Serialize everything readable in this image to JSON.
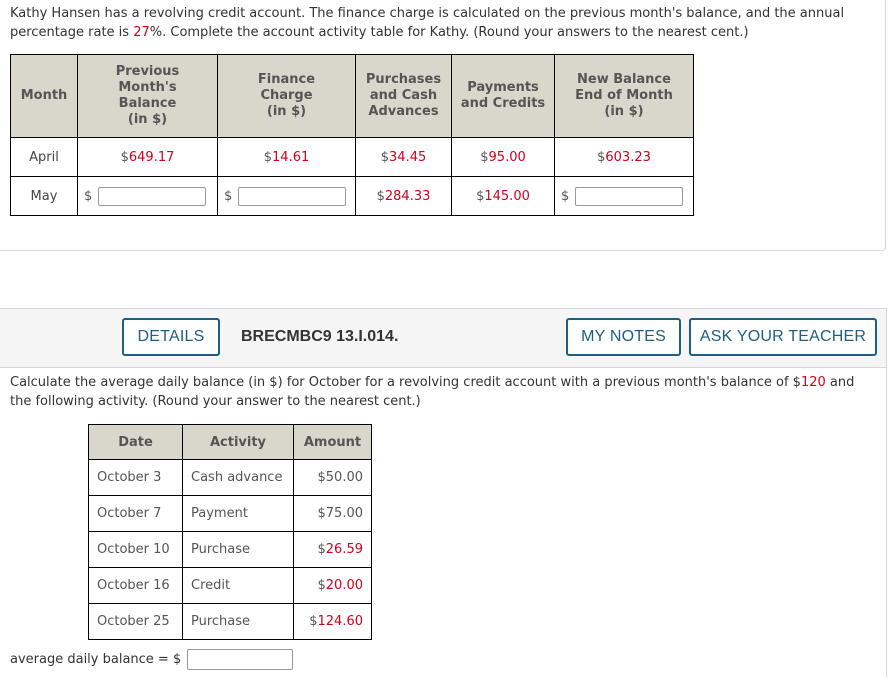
{
  "question1": {
    "text_before": "Kathy Hansen has a revolving credit account. The finance charge is calculated on the previous month's balance, and the annual percentage rate is ",
    "apr": "27",
    "text_after": "%. Complete the account activity table for Kathy. (Round your answers to the nearest cent.)",
    "table": {
      "headers": [
        "Month",
        "Previous Month's Balance (in $)",
        "Finance Charge (in $)",
        "Purchases and Cash Advances",
        "Payments and Credits",
        "New Balance End of Month (in $)"
      ],
      "header_lines": [
        [
          "Month"
        ],
        [
          "Previous",
          "Month's",
          "Balance",
          "(in $)"
        ],
        [
          "Finance",
          "Charge",
          "(in $)"
        ],
        [
          "Purchases",
          "and Cash",
          "Advances"
        ],
        [
          "Payments",
          "and Credits"
        ],
        [
          "New Balance",
          "End of Month",
          "(in $)"
        ]
      ],
      "rows": [
        {
          "month": "April",
          "previous_balance": "649.17",
          "finance_charge": "14.61",
          "purchases": "34.45",
          "payments": "95.00",
          "new_balance": "603.23"
        },
        {
          "month": "May",
          "previous_balance_input": "",
          "finance_charge_input": "",
          "purchases": "284.33",
          "payments": "145.00",
          "new_balance_input": ""
        }
      ],
      "currency": "$"
    }
  },
  "question2": {
    "header": {
      "details_label": "DETAILS",
      "code": "BRECMBC9 13.I.014.",
      "my_notes_label": "MY NOTES",
      "ask_teacher_label": "ASK YOUR TEACHER"
    },
    "text_before": "Calculate the average daily balance (in $) for October for a revolving credit account with a previous month's balance of $",
    "previous_balance": "120",
    "text_after": " and the following activity. (Round your answer to the nearest cent.)",
    "table": {
      "headers": [
        "Date",
        "Activity",
        "Amount"
      ],
      "rows": [
        {
          "date": "October 3",
          "activity": "Cash advance",
          "amount": "50.00",
          "highlight": false
        },
        {
          "date": "October 7",
          "activity": "Payment",
          "amount": "75.00",
          "highlight": false
        },
        {
          "date": "October 10",
          "activity": "Purchase",
          "amount": "26.59",
          "highlight": true
        },
        {
          "date": "October 16",
          "activity": "Credit",
          "amount": "20.00",
          "highlight": true
        },
        {
          "date": "October 25",
          "activity": "Purchase",
          "amount": "124.60",
          "highlight": true
        }
      ]
    },
    "answer_label": "average daily balance = $",
    "answer_value": ""
  },
  "colors": {
    "accent": "#1d5e84",
    "highlight_red": "#d0021b",
    "table_header_bg": "#d9d6cc"
  }
}
